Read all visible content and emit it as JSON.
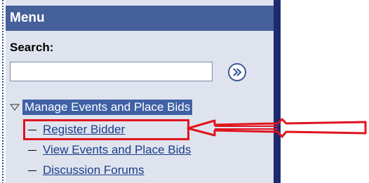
{
  "menu": {
    "title": "Menu",
    "search_label": "Search:",
    "search_value": "",
    "search_placeholder": ""
  },
  "tree": {
    "root_label": "Manage Events and Place Bids",
    "items": [
      {
        "label": "Register Bidder",
        "highlighted": true
      },
      {
        "label": "View Events and Place Bids",
        "highlighted": false
      },
      {
        "label": "Discussion Forums",
        "highlighted": false
      }
    ]
  },
  "colors": {
    "header_bg": "#46609a",
    "panel_bg": "#dfe3ee",
    "selected_bg": "#3f61a6",
    "link": "#1a3e8a",
    "annotation_red": "#e0141d"
  },
  "icons": {
    "go": "double-chevron-right-icon",
    "expand": "triangle-down-icon"
  }
}
